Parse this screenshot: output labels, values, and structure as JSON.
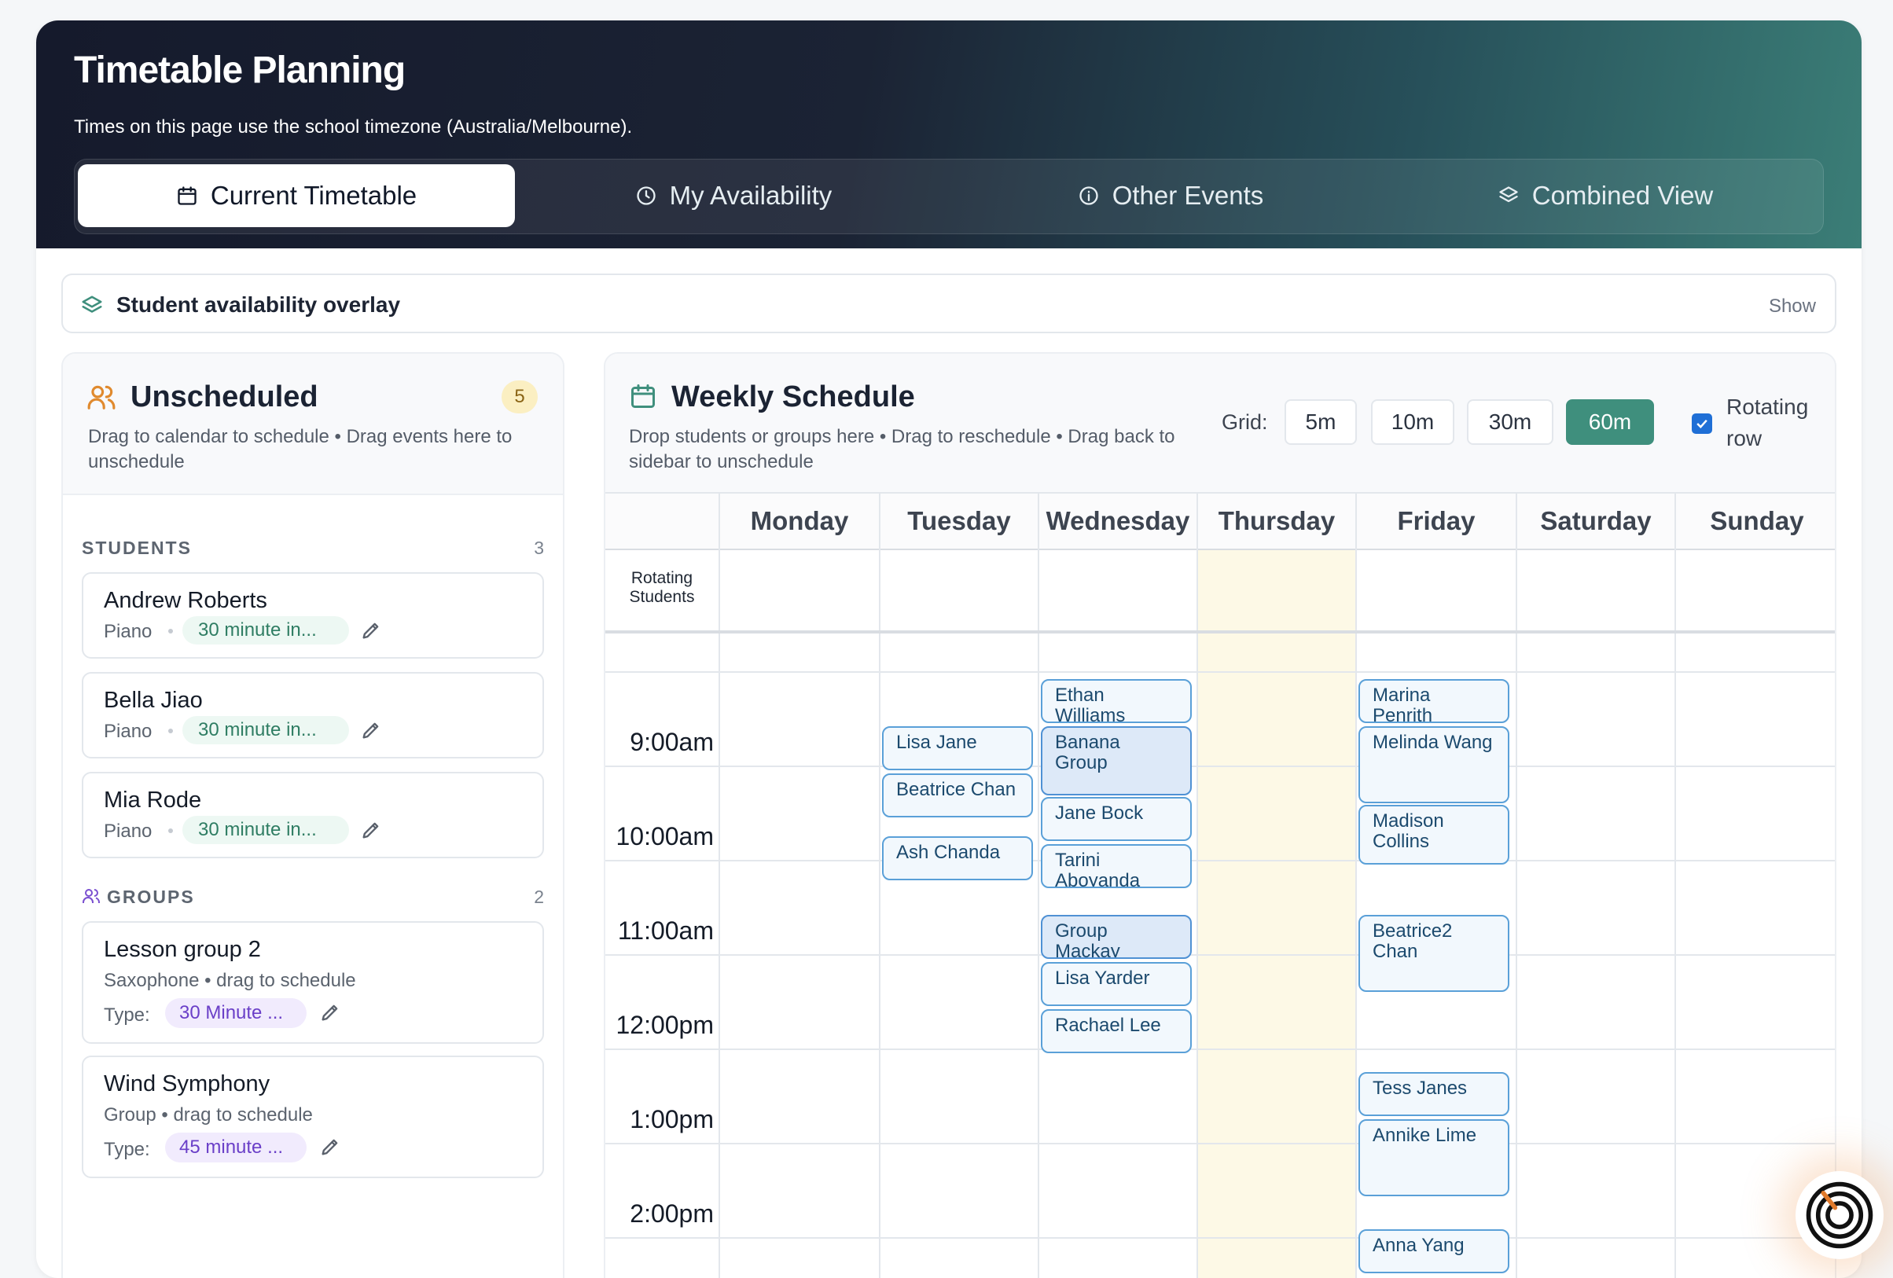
{
  "header": {
    "title": "Timetable Planning",
    "subtitle": "Times on this page use the school timezone (Australia/Melbourne).",
    "tabs": [
      {
        "label": "Current Timetable",
        "icon": "calendar-icon"
      },
      {
        "label": "My Availability",
        "icon": "clock-icon"
      },
      {
        "label": "Other Events",
        "icon": "info-icon"
      },
      {
        "label": "Combined View",
        "icon": "layers-icon"
      }
    ]
  },
  "overlay": {
    "title": "Student availability overlay",
    "action": "Show"
  },
  "sidebar": {
    "title": "Unscheduled",
    "count": "5",
    "description": "Drag to calendar to schedule • Drag events here to unschedule",
    "students_heading": "STUDENTS",
    "students_count": "3",
    "students": [
      {
        "name": "Andrew Roberts",
        "instrument": "Piano",
        "lesson": "30 minute in..."
      },
      {
        "name": "Bella Jiao",
        "instrument": "Piano",
        "lesson": "30 minute in..."
      },
      {
        "name": "Mia Rode",
        "instrument": "Piano",
        "lesson": "30 minute in..."
      }
    ],
    "groups_heading": "GROUPS",
    "groups_count": "2",
    "type_label": "Type:",
    "groups": [
      {
        "name": "Lesson group 2",
        "meta": "Saxophone • drag to schedule",
        "type": "30 Minute ..."
      },
      {
        "name": "Wind Symphony",
        "meta": "Group • drag to schedule",
        "type": "45 minute ..."
      }
    ]
  },
  "schedule": {
    "title": "Weekly Schedule",
    "description": "Drop students or groups here • Drag to reschedule • Drag back to sidebar to unschedule",
    "grid_label": "Grid:",
    "grid_options": [
      "5m",
      "10m",
      "30m",
      "60m"
    ],
    "grid_selected": "60m",
    "rotating_label": "Rotating row",
    "rotating_checked": true,
    "days": [
      "Monday",
      "Tuesday",
      "Wednesday",
      "Thursday",
      "Friday",
      "Saturday",
      "Sunday"
    ],
    "rotating_row_label": "Rotating Students",
    "times": [
      "9:00am",
      "10:00am",
      "11:00am",
      "12:00pm",
      "1:00pm",
      "2:00pm"
    ],
    "events": {
      "tuesday": [
        "Lisa Jane",
        "Beatrice Chan",
        "Ash Chanda"
      ],
      "wednesday": [
        "Ethan Williams",
        "Banana Group",
        "Jane Bock",
        "Tarini Aboyanda",
        "Group Mackay",
        "Lisa Yarder",
        "Rachael Lee"
      ],
      "friday": [
        "Marina Penrith",
        "Melinda Wang",
        "Madison Collins",
        "Beatrice2 Chan",
        "Tess Janes",
        "Annike Lime",
        "Anna Yang"
      ]
    }
  }
}
